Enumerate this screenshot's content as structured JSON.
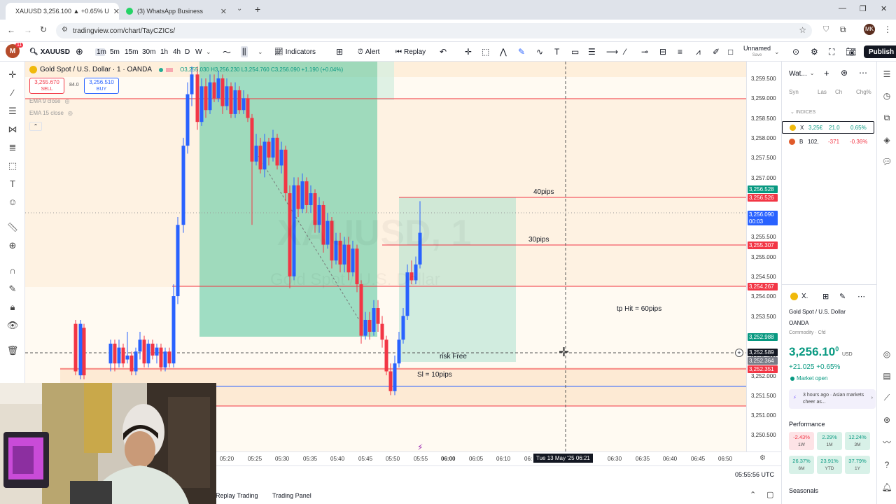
{
  "browser": {
    "tabs": [
      {
        "label": "XAUUSD 3,256.100 ▲ +0.65% U",
        "active": true
      },
      {
        "label": "(3) WhatsApp Business",
        "active": false
      }
    ],
    "url": "tradingview.com/chart/TayCZICs/",
    "profile_initials": "MK"
  },
  "toolbar": {
    "avatar_initial": "M",
    "notif_count": "11",
    "symbol": "XAUUSD",
    "intervals": [
      "1m",
      "5m",
      "15m",
      "30m",
      "1h",
      "4h",
      "D",
      "W"
    ],
    "indicators_label": "Indicators",
    "alert_label": "Alert",
    "replay_label": "Replay",
    "layout_name": "Unnamed",
    "layout_state": "Save",
    "publish_label": "Publish"
  },
  "legend": {
    "title": "Gold Spot / U.S. Dollar · 1 · OANDA",
    "ohlc": "O3,255.030 H3,256.230 L3,254.760 C3,256.090 +1.190 (+0.04%)",
    "sell_price": "3,255.670",
    "sell_label": "SELL",
    "spread": "84.0",
    "buy_price": "3,256.510",
    "buy_label": "BUY",
    "ema9": "EMA 9 close",
    "ema15": "EMA 15 close"
  },
  "watermark": {
    "symbol": "XAUUSD, 1",
    "name": "Gold Spot / U.S. Dollar"
  },
  "annotations": {
    "pips40": "40pips",
    "pips30": "30pips",
    "tp_hit": "tp Hit = 60pips",
    "risk_free": "risk Free",
    "sl": "Sl = 10pips"
  },
  "price_axis": {
    "labels": [
      "3,259.500",
      "3,259.000",
      "3,258.500",
      "3,258.000",
      "3,257.500",
      "3,257.000",
      "3,256.500",
      "3,256.000",
      "3,255.500",
      "3,255.000",
      "3,254.500",
      "3,254.000",
      "3,253.500",
      "3,253.000",
      "3,252.500",
      "3,252.000",
      "3,251.500",
      "3,251.000",
      "3,250.500"
    ],
    "badges": [
      {
        "text": "3,256.528",
        "color": "#089981"
      },
      {
        "text": "3,256.526",
        "color": "#f23645"
      },
      {
        "text": "3,256.090",
        "color": "#2962ff"
      },
      {
        "text": "00:03",
        "color": "#2962ff"
      },
      {
        "text": "3,255.307",
        "color": "#f23645"
      },
      {
        "text": "3,254.267",
        "color": "#f23645"
      },
      {
        "text": "3,252.988",
        "color": "#089981"
      },
      {
        "text": "3,252.589",
        "color": "#131722"
      },
      {
        "text": "3,252.364",
        "color": "#787b86"
      },
      {
        "text": "3,252.351",
        "color": "#f23645"
      }
    ]
  },
  "time_axis": {
    "labels": [
      "05:20",
      "05:25",
      "05:30",
      "05:35",
      "05:40",
      "05:45",
      "05:50",
      "05:55",
      "06:00",
      "06:05",
      "06:10",
      "06:",
      "06:30",
      "06:35",
      "06:40",
      "06:45",
      "06:50"
    ],
    "cursor_label": "Tue 13 May '25   06:21",
    "clock": "05:55:56 UTC"
  },
  "bottom": {
    "replay_trading": "Replay Trading",
    "trading_panel": "Trading Panel"
  },
  "watchlist": {
    "title": "Wat...",
    "columns": [
      "Syn",
      "Las",
      "Ch",
      "Chg%"
    ],
    "section": "INDICES",
    "rows": [
      {
        "sym": "X",
        "last": "3,25€",
        "chg": "21.0",
        "chgp": "0.65%",
        "color": "#089981"
      },
      {
        "sym": "B",
        "last": "102,",
        "chg": "-371",
        "chgp": "-0.36%",
        "color": "#f23645"
      }
    ]
  },
  "details": {
    "sym": "X.",
    "name": "Gold Spot / U.S. Dollar",
    "exchange": "OANDA",
    "category": "Commodity · Cfd",
    "price": "3,256.10",
    "price_sup": "0",
    "currency": "USD",
    "change": "+21.025 +0.65%",
    "market_status": "Market open",
    "news": "3 hours ago · Asian markets cheer as...",
    "performance_title": "Performance",
    "perf": [
      {
        "value": "-2.43%",
        "period": "1W",
        "neg": true
      },
      {
        "value": "2.29%",
        "period": "1M",
        "neg": false
      },
      {
        "value": "12.24%",
        "period": "3M",
        "neg": false
      },
      {
        "value": "26.37%",
        "period": "6M",
        "neg": false
      },
      {
        "value": "23.91%",
        "period": "YTD",
        "neg": false
      },
      {
        "value": "37.79%",
        "period": "1Y",
        "neg": false
      }
    ],
    "seasonals": "Seasonals"
  }
}
